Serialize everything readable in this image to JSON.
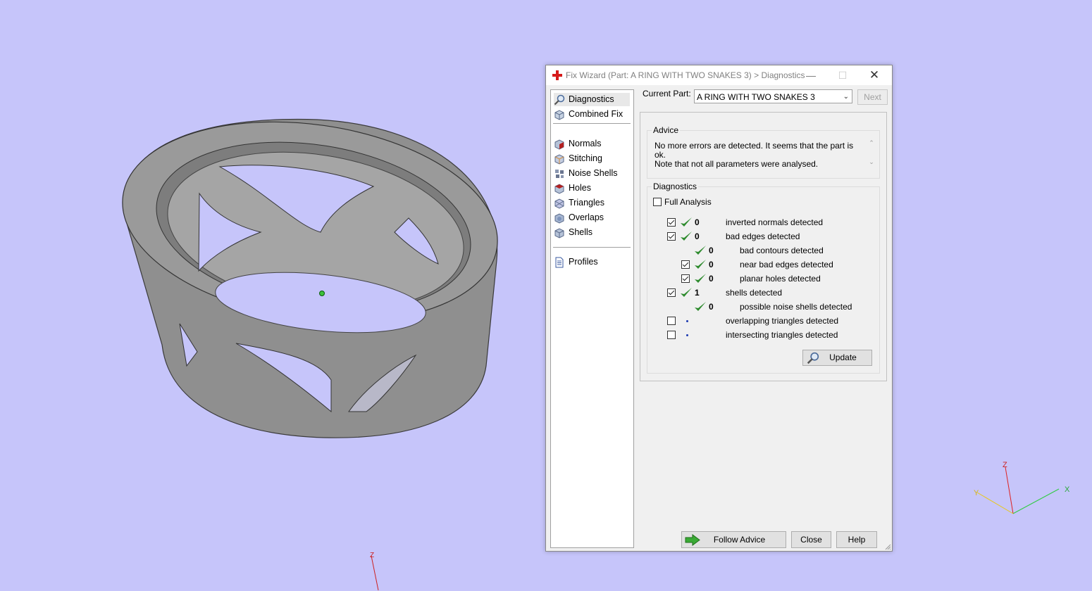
{
  "dialog": {
    "title": "Fix Wizard (Part: A RING WITH TWO SNAKES 3) > Diagnostics",
    "controls": {
      "minimize": "—",
      "maximize": "☐",
      "close": "✕"
    }
  },
  "nav": {
    "items": [
      {
        "label": "Diagnostics",
        "icon": "magnifier-icon"
      },
      {
        "label": "Combined Fix",
        "icon": "cube-icon"
      },
      {
        "label": "Normals",
        "icon": "normals-cube-icon"
      },
      {
        "label": "Stitching",
        "icon": "stitching-cube-icon"
      },
      {
        "label": "Noise Shells",
        "icon": "noise-shells-icon"
      },
      {
        "label": "Holes",
        "icon": "holes-cube-icon"
      },
      {
        "label": "Triangles",
        "icon": "triangles-cube-icon"
      },
      {
        "label": "Overlaps",
        "icon": "overlaps-cube-icon"
      },
      {
        "label": "Shells",
        "icon": "shells-cube-icon"
      },
      {
        "label": "Profiles",
        "icon": "document-icon"
      }
    ]
  },
  "current_part": {
    "label": "Current Part:",
    "value": "A RING WITH TWO SNAKES 3",
    "next_label": "Next"
  },
  "advice": {
    "title": "Advice",
    "line1": "No more errors are detected. It seems that the part is ok.",
    "line2": "Note that not all parameters were analysed."
  },
  "diagnostics": {
    "title": "Diagnostics",
    "full_analysis_label": "Full Analysis",
    "rows": [
      {
        "label": "inverted normals detected",
        "count": "0"
      },
      {
        "label": "bad edges detected",
        "count": "0"
      },
      {
        "label": "bad contours detected",
        "count": "0"
      },
      {
        "label": "near bad edges detected",
        "count": "0"
      },
      {
        "label": "planar holes detected",
        "count": "0"
      },
      {
        "label": "shells detected",
        "count": "1"
      },
      {
        "label": "possible noise shells detected",
        "count": "0"
      },
      {
        "label": "overlapping triangles detected",
        "count": ""
      },
      {
        "label": "intersecting triangles detected",
        "count": ""
      }
    ],
    "update_label": "Update"
  },
  "footer": {
    "follow_advice_label": "Follow Advice",
    "close_label": "Close",
    "help_label": "Help"
  },
  "axes": {
    "x": "X",
    "y": "Y",
    "z": "Z",
    "z2": "Z"
  },
  "colors": {
    "viewport_bg": "#c6c5fa",
    "model_gray": "#8c8c8c",
    "check_green": "#2e8b2e"
  }
}
